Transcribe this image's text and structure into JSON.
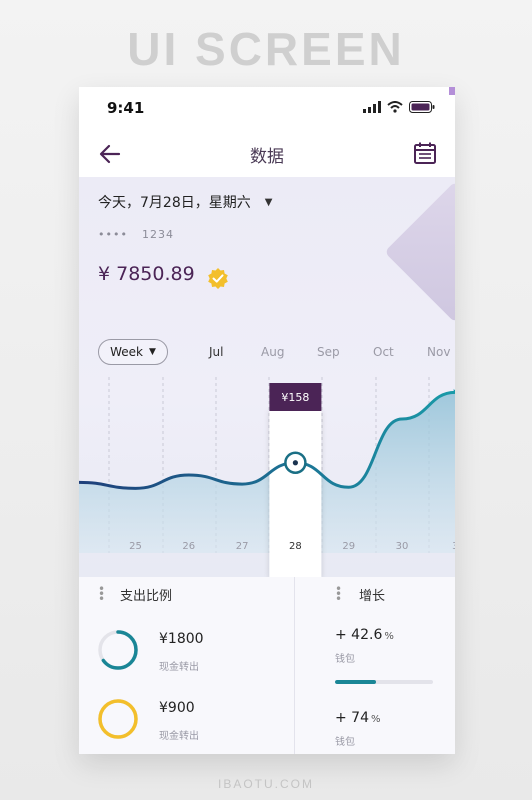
{
  "banner": "UI SCREEN",
  "footer": "IBAOTU.COM",
  "status": {
    "time": "9:41"
  },
  "nav": {
    "title": "数据"
  },
  "summary": {
    "date": "今天，7月28日，星期六",
    "card_mask": "••••",
    "card_last": "1234",
    "balance": "¥ 7850.89"
  },
  "chart": {
    "period": "Week",
    "months": [
      "Jul",
      "Aug",
      "Sep",
      "Oct",
      "Nov"
    ],
    "active_month": "Jul",
    "tooltip": "¥158",
    "selected_day": "28",
    "days": [
      "25",
      "26",
      "27",
      "28",
      "29",
      "30",
      "3"
    ]
  },
  "chart_data": {
    "type": "area",
    "x": [
      "25",
      "26",
      "27",
      "28",
      "29",
      "30",
      "3"
    ],
    "values": [
      110,
      135,
      118,
      158,
      112,
      240,
      290
    ],
    "selected_index": 3,
    "selected_label": "¥158",
    "colors": {
      "line_start": "#1e3f7a",
      "line_end": "#1a9aa8",
      "fill": "#bcd6e4"
    }
  },
  "spend": {
    "title": "支出比例",
    "items": [
      {
        "amount": "¥1800",
        "label": "现金转出",
        "fraction": 0.65,
        "color": "#1a8696"
      },
      {
        "amount": "¥900",
        "label": "现金转出",
        "fraction": 1.0,
        "color": "#f3bf2b"
      }
    ]
  },
  "growth": {
    "title": "增长",
    "items": [
      {
        "value": "+ 42.6",
        "unit": "%",
        "label": "钱包",
        "progress": 0.42
      },
      {
        "value": "+ 74",
        "unit": "%",
        "label": "钱包"
      }
    ]
  },
  "colors": {
    "brand": "#4b2456",
    "accent": "#1a8696",
    "gold": "#f3bf2b"
  }
}
